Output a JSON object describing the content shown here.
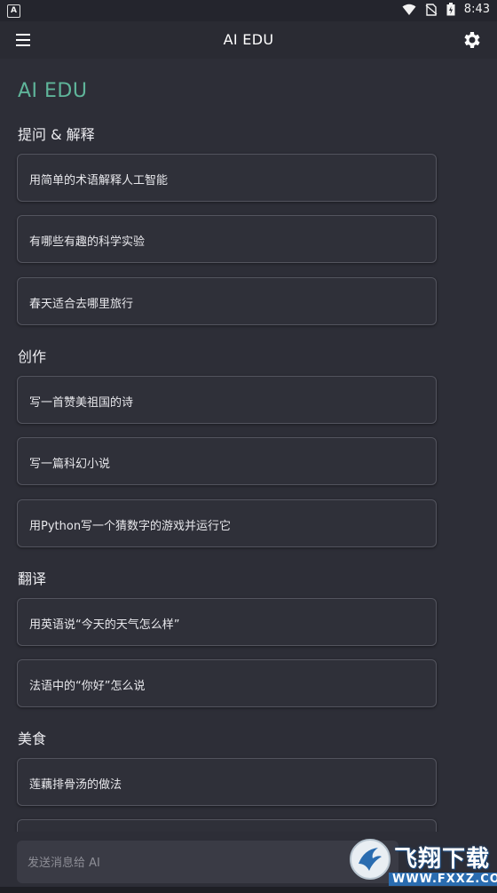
{
  "status_bar": {
    "time": "8:43",
    "left_icon": "A"
  },
  "app_bar": {
    "title": "AI EDU",
    "menu_icon": "hamburger-menu-icon",
    "settings_icon": "gear-icon"
  },
  "hero": {
    "title": "AI EDU"
  },
  "colors": {
    "accent": "#5fb59a",
    "background": "#2d2e37",
    "card_border": "#53545e"
  },
  "sections": [
    {
      "title": "提问 & 解释",
      "items": [
        "用简单的术语解释人工智能",
        "有哪些有趣的科学实验",
        "春天适合去哪里旅行"
      ]
    },
    {
      "title": "创作",
      "items": [
        "写一首赞美祖国的诗",
        "写一篇科幻小说",
        "用Python写一个猜数字的游戏并运行它"
      ]
    },
    {
      "title": "翻译",
      "items": [
        "用英语说“今天的天气怎么样”",
        "法语中的“你好”怎么说"
      ]
    },
    {
      "title": "美食",
      "items": [
        "莲藕排骨汤的做法"
      ]
    }
  ],
  "input": {
    "placeholder": "发送消息给 AI"
  },
  "watermark": {
    "text": "飞翔下载",
    "url": "WWW.FXXZ.COM"
  }
}
